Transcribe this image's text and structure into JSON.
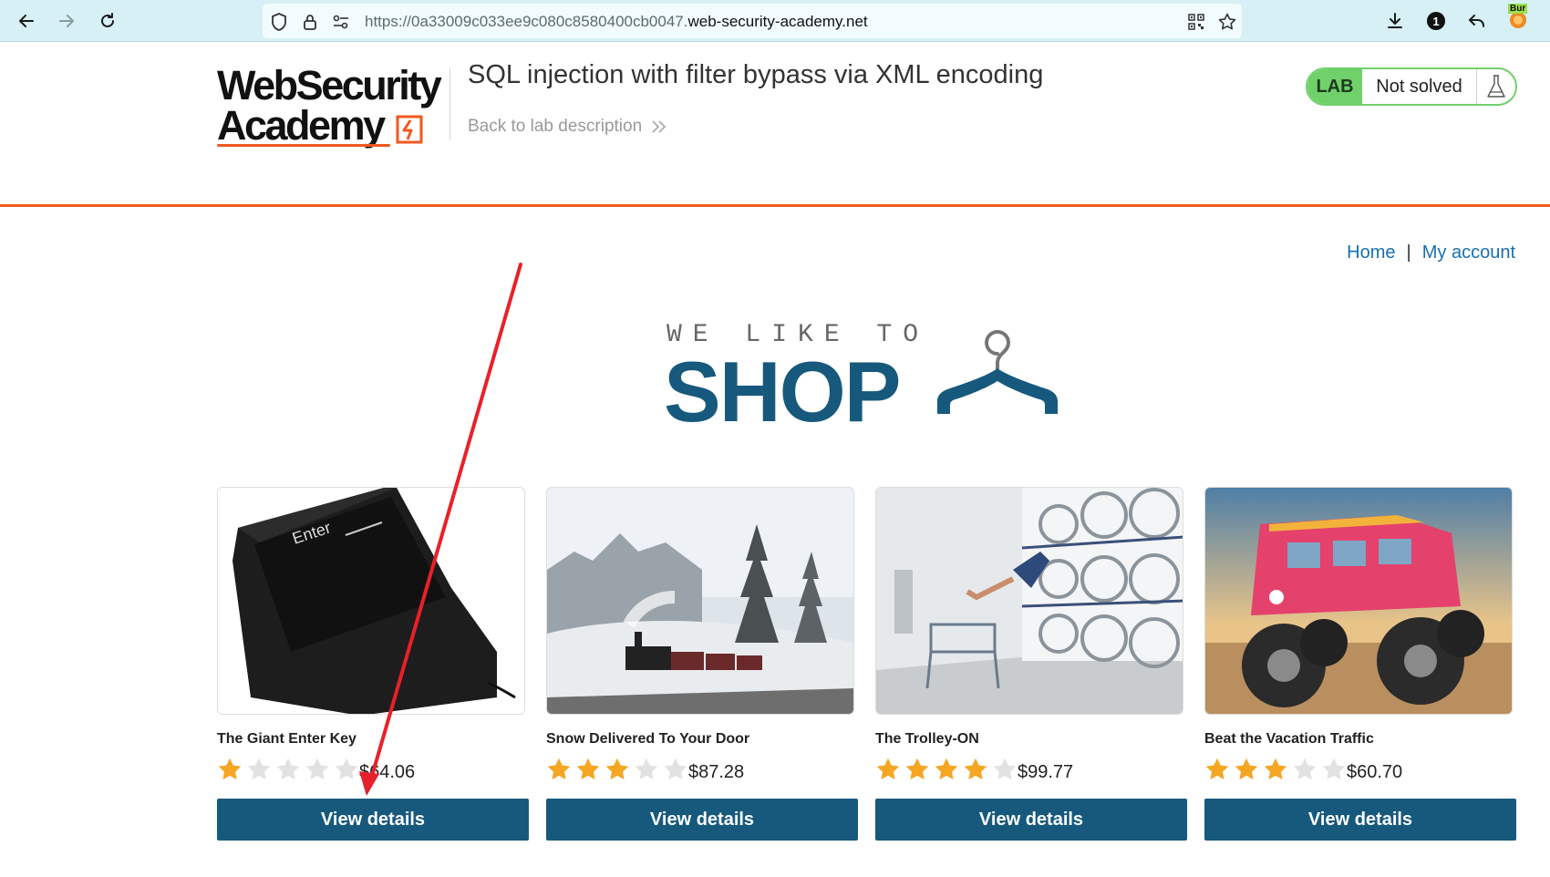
{
  "browser": {
    "url_prefix": "https://0a33009c033ee9c080c8580400cb0047.",
    "url_domain": "web-security-academy.net",
    "notification_count": "1",
    "extension_label": "Bur"
  },
  "header": {
    "logo_line1": "WebSecurity",
    "logo_line2": "Academy",
    "lab_title": "SQL injection with filter bypass via XML encoding",
    "back_link": "Back to lab description",
    "lab_badge": "LAB",
    "lab_status": "Not solved"
  },
  "nav": {
    "home": "Home",
    "separator": "|",
    "my_account": "My account"
  },
  "banner": {
    "tagline": "WE LIKE TO",
    "headline": "SHOP"
  },
  "products": [
    {
      "name": "The Giant Enter Key",
      "rating": 1,
      "price": "$64.06",
      "button": "View details",
      "image": "enter-key-image"
    },
    {
      "name": "Snow Delivered To Your Door",
      "rating": 3,
      "price": "$87.28",
      "button": "View details",
      "image": "snow-train-image"
    },
    {
      "name": "The Trolley-ON",
      "rating": 4,
      "price": "$99.77",
      "button": "View details",
      "image": "laundromat-image"
    },
    {
      "name": "Beat the Vacation Traffic",
      "rating": 3,
      "price": "$60.70",
      "button": "View details",
      "image": "monster-van-image"
    }
  ],
  "colors": {
    "brand_blue": "#16597c",
    "accent_orange": "#f1591f",
    "lab_green": "#70d16b",
    "link_blue": "#1a6fb0",
    "star_gold": "#f5a623",
    "star_empty": "#e2e2e2",
    "annotation_red": "#e8202a"
  }
}
